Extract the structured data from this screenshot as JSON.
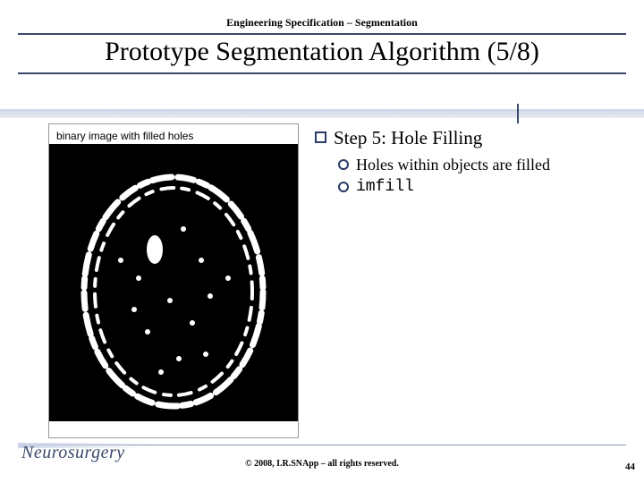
{
  "header": {
    "pretitle": "Engineering Specification – Segmentation",
    "title": "Prototype Segmentation Algorithm (5/8)"
  },
  "figure": {
    "caption": "binary image with filled holes"
  },
  "bullets": {
    "step_title": "Step 5: Hole Filling",
    "sub1": "Holes within objects are filled",
    "sub2_code": "imfill"
  },
  "footer": {
    "logo": "Neurosurgery",
    "copyright": "© 2008, I.R.SNApp – all rights reserved.",
    "page": "44"
  }
}
